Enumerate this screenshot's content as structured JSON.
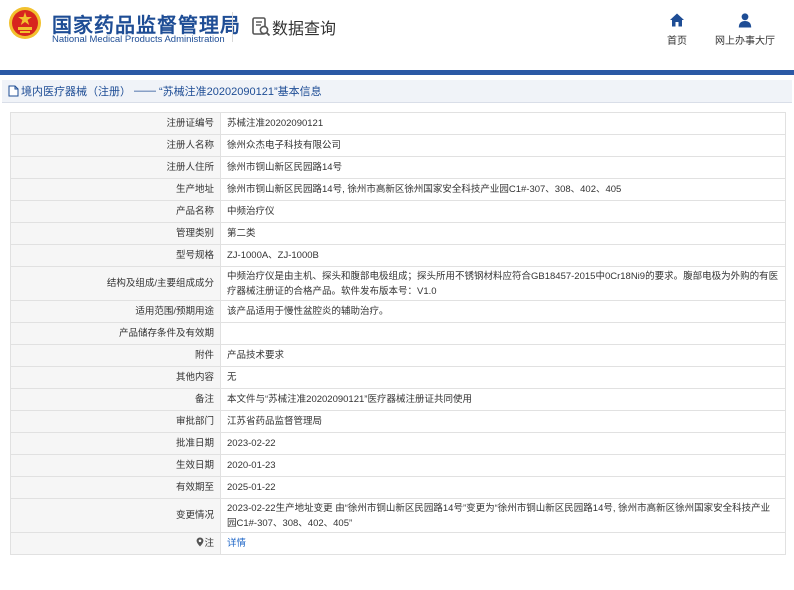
{
  "header": {
    "brand_cn": "国家药品监督管理局",
    "brand_en": "National Medical Products Administration",
    "search_title": "数据查询",
    "nav": {
      "home": "首页",
      "hall": "网上办事大厅"
    }
  },
  "breadcrumb": {
    "category": "境内医疗器械（注册）",
    "separator": "——",
    "title": "“苏械注准20202090121”基本信息"
  },
  "fields": [
    {
      "label": "注册证编号",
      "value": "苏械注准20202090121"
    },
    {
      "label": "注册人名称",
      "value": "徐州众杰电子科技有限公司"
    },
    {
      "label": "注册人住所",
      "value": "徐州市铜山新区民园路14号"
    },
    {
      "label": "生产地址",
      "value": "徐州市铜山新区民园路14号, 徐州市高新区徐州国家安全科技产业园C1#-307、308、402、405"
    },
    {
      "label": "产品名称",
      "value": "中频治疗仪"
    },
    {
      "label": "管理类别",
      "value": "第二类"
    },
    {
      "label": "型号规格",
      "value": "ZJ-1000A、ZJ-1000B"
    },
    {
      "label": "结构及组成/主要组成成分",
      "value": "中频治疗仪是由主机、探头和腹部电极组成；探头所用不锈钢材料应符合GB18457-2015中0Cr18Ni9的要求。腹部电极为外购的有医疗器械注册证的合格产品。软件发布版本号：V1.0"
    },
    {
      "label": "适用范围/预期用途",
      "value": "该产品适用于慢性盆腔炎的辅助治疗。"
    },
    {
      "label": "产品储存条件及有效期",
      "value": ""
    },
    {
      "label": "附件",
      "value": "产品技术要求"
    },
    {
      "label": "其他内容",
      "value": "无"
    },
    {
      "label": "备注",
      "value": "本文件与“苏械注准20202090121”医疗器械注册证共同使用"
    },
    {
      "label": "审批部门",
      "value": "江苏省药品监督管理局"
    },
    {
      "label": "批准日期",
      "value": "2023-02-22"
    },
    {
      "label": "生效日期",
      "value": "2020-01-23"
    },
    {
      "label": "有效期至",
      "value": "2025-01-22"
    },
    {
      "label": "变更情况",
      "value": "2023-02-22生产地址变更 由“徐州市铜山新区民园路14号”变更为“徐州市铜山新区民园路14号, 徐州市高新区徐州国家安全科技产业园C1#-307、308、402、405”"
    }
  ],
  "note": {
    "label": "注",
    "link": "详情"
  },
  "colors": {
    "brand_blue": "#1e4d95",
    "emblem_red": "#d7261e",
    "emblem_gold": "#f2c12e",
    "link_blue": "#1e66c7"
  },
  "icons": [
    "national-emblem-icon",
    "data-search-icon",
    "home-icon",
    "user-icon",
    "document-icon",
    "location-pin-icon"
  ]
}
